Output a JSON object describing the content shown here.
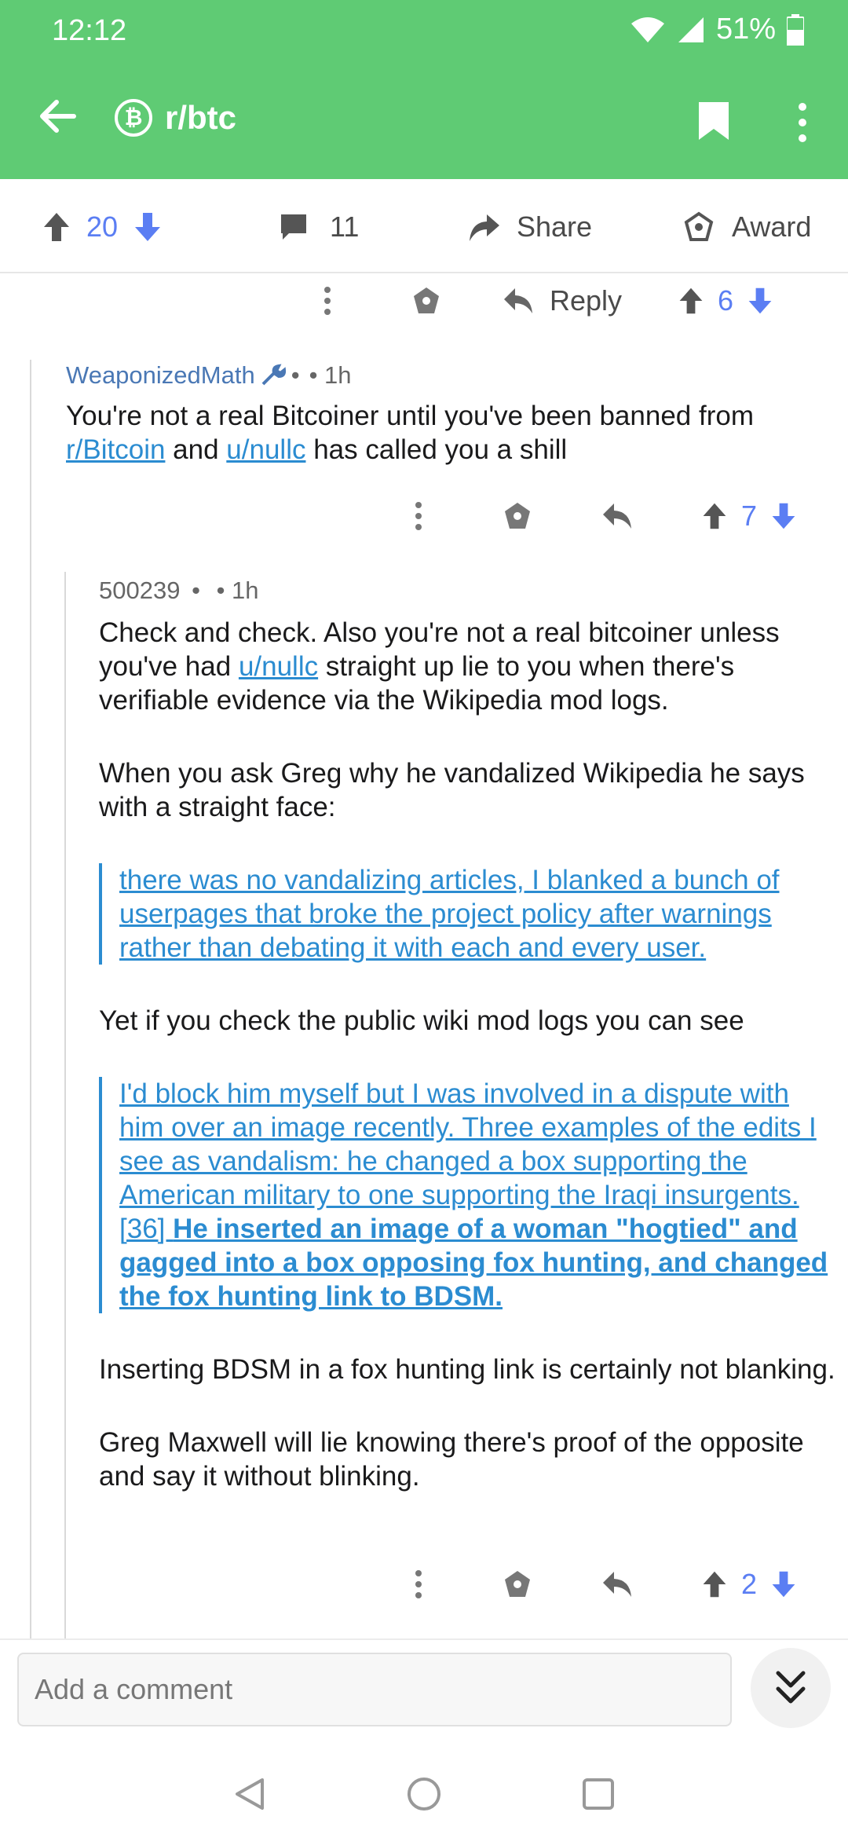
{
  "status": {
    "time": "12:12",
    "battery": "51%"
  },
  "header": {
    "subreddit": "r/btc",
    "subreddit_icon": "bitcoin-icon"
  },
  "post_actions": {
    "score": "20",
    "comments": "11",
    "share": "Share",
    "award": "Award"
  },
  "comment0_actions": {
    "reply": "Reply",
    "score": "6"
  },
  "comment1": {
    "author": "WeaponizedMath",
    "time": "• 1h",
    "sep": "•",
    "text_a": "You're not a real Bitcoiner until you've been banned from ",
    "link_a": "r/Bitcoin",
    "text_b": " and ",
    "link_b": "u/nullc",
    "text_c": " has called you a shill",
    "score": "7"
  },
  "comment2": {
    "author": "500239",
    "sep": "•",
    "time": "• 1h",
    "p1_a": "Check and check. Also you're not a real bitcoiner unless you've had ",
    "p1_link": "u/nullc",
    "p1_b": " straight up lie to you when there's verifiable evidence via the Wikipedia mod logs.",
    "p2": "When you ask Greg why he vandalized Wikipedia he says with a straight face:",
    "quote1": "there was no vandalizing articles, I blanked a bunch of userpages that broke the project policy after warnings rather than debating it with each and every user.",
    "p3": "Yet if you check the public wiki mod logs you can see",
    "quote2_a": "I'd block him myself but I was involved in a dispute with him over an image recently. Three examples of the edits I see as vandalism: he changed a box supporting the American military to one supporting the Iraqi insurgents. [36] ",
    "quote2_bold": "He inserted an image of a woman \"hogtied\" and gagged into a box opposing fox hunting, and changed the fox hunting link to BDSM.",
    "p4": "Inserting BDSM in a fox hunting link is certainly not blanking.",
    "p5": "Greg Maxwell will lie knowing there's proof of the opposite and say it without blinking.",
    "score": "2"
  },
  "bottom": {
    "placeholder": "Add a comment"
  },
  "colors": {
    "appbar": "#5fcb74",
    "vote": "#5b7ef3",
    "link": "#2b8cd1"
  }
}
